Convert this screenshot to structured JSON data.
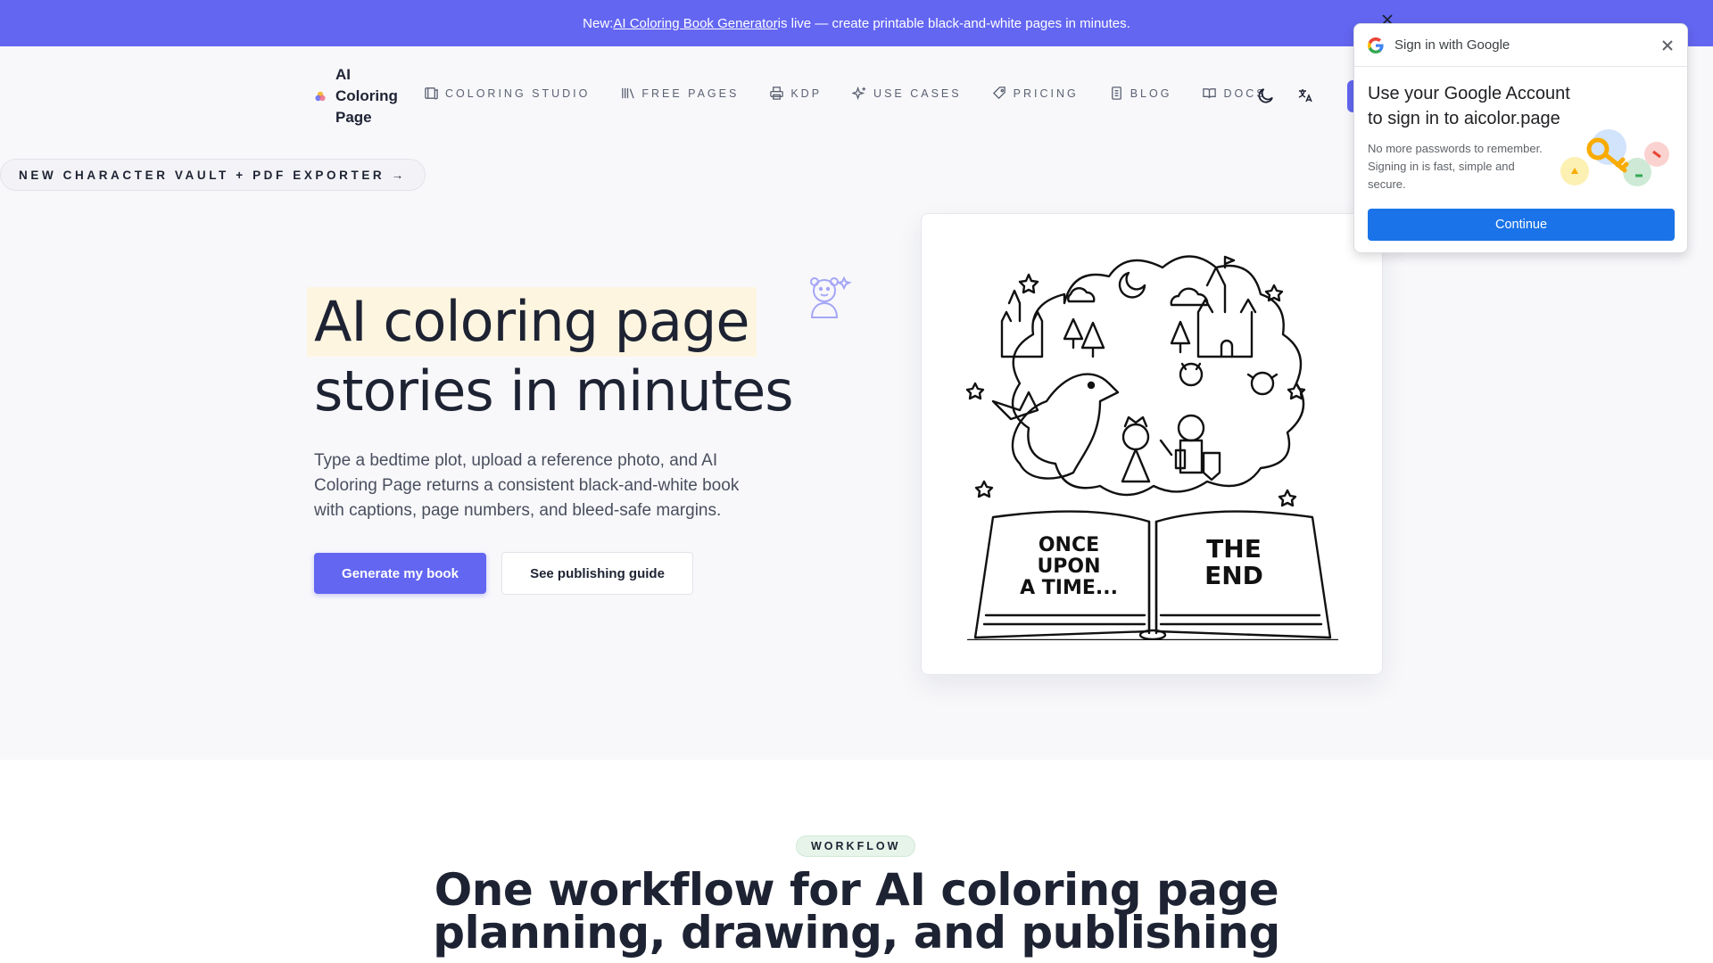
{
  "announcement": {
    "prefix": "New: ",
    "link_text": "AI Coloring Book Generator",
    "suffix": " is live — create printable black-and-white pages in minutes."
  },
  "brand": {
    "name": "AI Coloring Page"
  },
  "nav": {
    "items": [
      {
        "label": "Coloring Studio",
        "icon": "book-open-icon"
      },
      {
        "label": "Free Pages",
        "icon": "library-icon"
      },
      {
        "label": "KDP",
        "icon": "printer-icon"
      },
      {
        "label": "Use Cases",
        "icon": "sparkles-icon"
      },
      {
        "label": "Pricing",
        "icon": "tag-icon"
      },
      {
        "label": "Blog",
        "icon": "document-icon"
      },
      {
        "label": "Docs",
        "icon": "open-book-icon"
      }
    ]
  },
  "pill": {
    "label": "NEW  CHARACTER VAULT + PDF EXPORTER →"
  },
  "hero": {
    "title_highlight": "AI coloring page",
    "title_rest": "stories in minutes",
    "subtitle": "Type a bedtime plot, upload a reference photo, and AI Coloring Page returns a consistent black-and-white book with captions, page numbers, and bleed-safe margins.",
    "primary_cta": "Generate my book",
    "secondary_cta": "See publishing guide"
  },
  "illustration": {
    "left_page_text": [
      "ONCE",
      "UPON",
      "A TIME..."
    ],
    "right_page_text": [
      "THE",
      "END"
    ]
  },
  "workflow": {
    "badge": "WORKFLOW",
    "title_line1": "One workflow for AI coloring page",
    "title_line2": "planning, drawing, and publishing"
  },
  "google_popup": {
    "header": "Sign in with Google",
    "title": "Use your Google Account to sign in to aicolor.page",
    "description": "No more passwords to remember. Signing in is fast, simple and secure.",
    "button": "Continue"
  },
  "colors": {
    "accent": "#6366f1",
    "google_blue": "#1a73e8"
  }
}
